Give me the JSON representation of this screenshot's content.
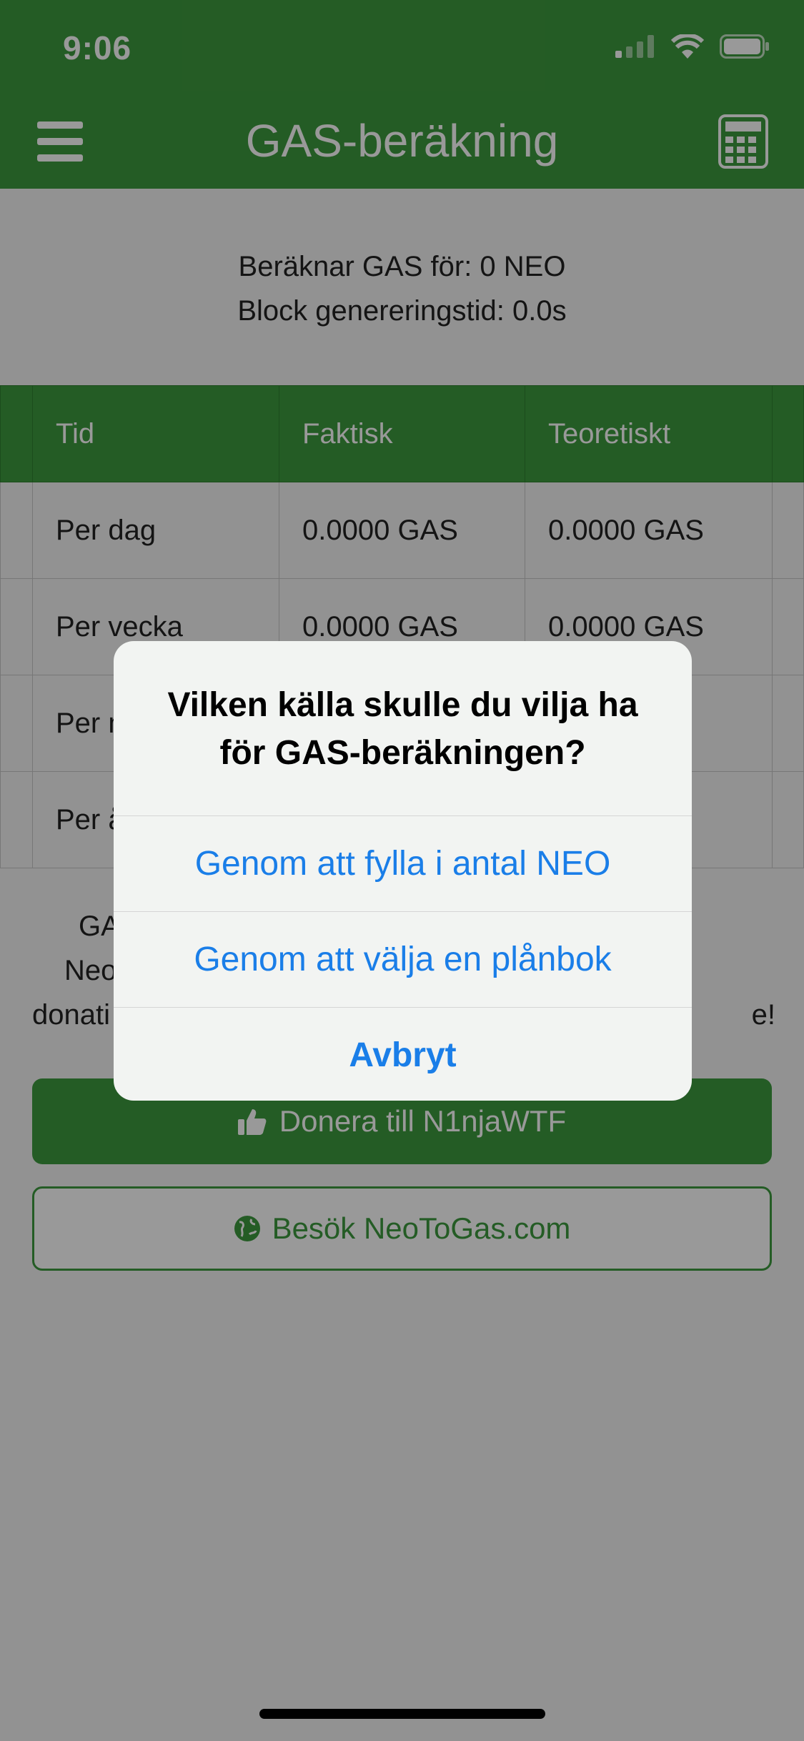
{
  "status": {
    "time": "9:06"
  },
  "nav": {
    "title": "GAS-beräkning",
    "menu_icon": "hamburger-menu-icon",
    "calc_icon": "calculator-icon"
  },
  "info": {
    "line1": "Beräknar GAS för: 0 NEO",
    "line2": "Block genereringstid: 0.0s"
  },
  "table": {
    "headers": [
      "Tid",
      "Faktisk",
      "Teoretiskt"
    ],
    "rows": [
      [
        "Per dag",
        "0.0000 GAS",
        "0.0000 GAS"
      ],
      [
        "Per vecka",
        "0.0000 GAS",
        "0.0000 GAS"
      ],
      [
        "Per m",
        "",
        ""
      ],
      [
        "Per å",
        "",
        ""
      ]
    ]
  },
  "footer": {
    "line1": "GA",
    "line2": "Neo",
    "line3": "donati",
    "line3_end": "e!"
  },
  "buttons": {
    "donate": "Donera till N1njaWTF",
    "visit": "Besök NeoToGas.com"
  },
  "alert": {
    "message": "Vilken källa skulle du vilja ha för GAS-beräkningen?",
    "action1": "Genom att fylla i antal NEO",
    "action2": "Genom att välja en plånbok",
    "cancel": "Avbryt"
  },
  "colors": {
    "accent": "#3d9a3e",
    "ios_blue": "#1a7ee8"
  }
}
